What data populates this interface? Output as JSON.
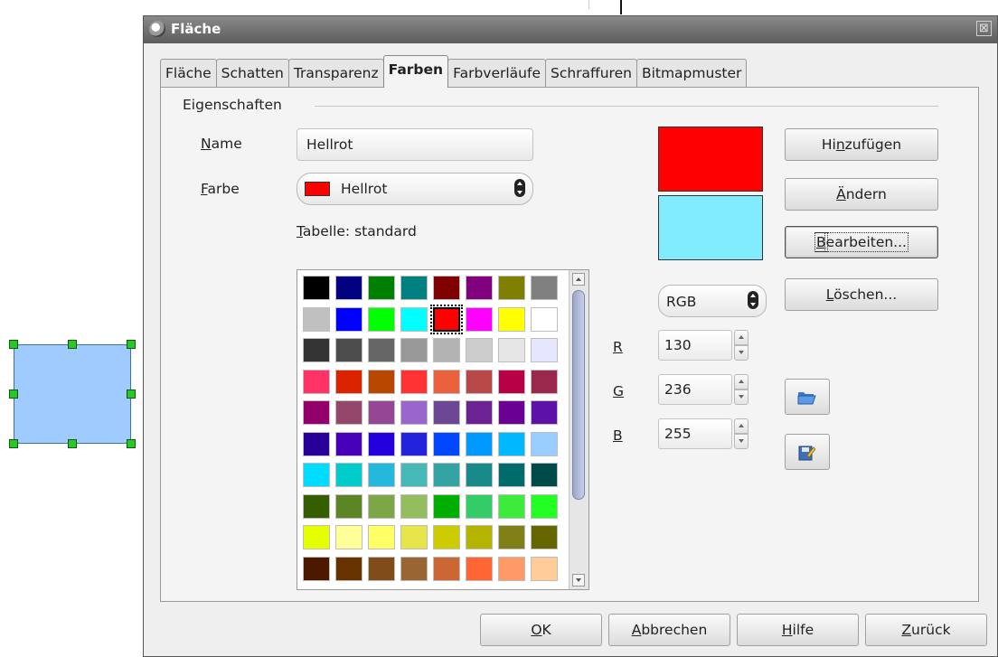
{
  "dialog": {
    "title": "Fläche",
    "close_glyph": "⊠"
  },
  "tabs": [
    {
      "label": "Fläche"
    },
    {
      "label": "Schatten"
    },
    {
      "label": "Transparenz"
    },
    {
      "label": "Farben",
      "active": true
    },
    {
      "label": "Farbverläufe"
    },
    {
      "label": "Schraffuren"
    },
    {
      "label": "Bitmapmuster"
    }
  ],
  "properties": {
    "section_title": "Eigenschaften",
    "name_label_u": "N",
    "name_label_rest": "ame",
    "name_value": "Hellrot",
    "color_label_u": "F",
    "color_label_rest": "arbe",
    "color_value": "Hellrot",
    "color_swatch": "#ff0000",
    "table_label_u": "T",
    "table_label_rest": "abelle: standard"
  },
  "palette": [
    [
      "#000000",
      "#000080",
      "#008000",
      "#008080",
      "#800000",
      "#800080",
      "#808000",
      "#808080"
    ],
    [
      "#c0c0c0",
      "#0000ff",
      "#00ff00",
      "#00ffff",
      "#ff0000",
      "#ff00ff",
      "#ffff00",
      "#ffffff"
    ],
    [
      "#333333",
      "#4d4d4d",
      "#666666",
      "#999999",
      "#b3b3b3",
      "#cccccc",
      "#e6e6e6",
      "#e6e6ff"
    ],
    [
      "#ff3366",
      "#dc2300",
      "#b84700",
      "#ff3333",
      "#eb613d",
      "#b84747",
      "#b80047",
      "#99284c"
    ],
    [
      "#94006b",
      "#94476b",
      "#944794",
      "#9966cc",
      "#6b4794",
      "#6b2394",
      "#6b0094",
      "#5e11a6"
    ],
    [
      "#280099",
      "#4700b8",
      "#2300dc",
      "#2323dc",
      "#0047ff",
      "#0099ff",
      "#00b8ff",
      "#99ccff"
    ],
    [
      "#00dcff",
      "#00cccc",
      "#23b8dc",
      "#47b8b8",
      "#33a3a3",
      "#198a8a",
      "#006b6b",
      "#004a4a"
    ],
    [
      "#355e00",
      "#5c8526",
      "#7da647",
      "#94bd5e",
      "#00ae00",
      "#33cc66",
      "#3deb3d",
      "#23ff23"
    ],
    [
      "#e6ff00",
      "#ffff99",
      "#ffff66",
      "#e6e64c",
      "#cccc00",
      "#b3b300",
      "#808019",
      "#666600"
    ],
    [
      "#4c1900",
      "#663300",
      "#804c19",
      "#996633",
      "#cc6633",
      "#ff6633",
      "#ff9966",
      "#ffcc99"
    ]
  ],
  "selected_color": {
    "row": 1,
    "col": 4
  },
  "preview": {
    "new_color": "#ff0000",
    "old_color": "#82ecff"
  },
  "color_model": {
    "value": "RGB"
  },
  "rgb": {
    "r_label": "R",
    "r_value": "130",
    "g_label": "G",
    "g_value": "236",
    "b_label": "B",
    "b_value": "255"
  },
  "buttons": {
    "add_pre": "Hi",
    "add_u": "n",
    "add_post": "zufügen",
    "modify_u": "Ä",
    "modify_post": "ndern",
    "edit_u": "B",
    "edit_post": "earbeiten...",
    "delete_u": "L",
    "delete_post": "öschen...",
    "ok_u": "O",
    "ok_post": "K",
    "cancel_u": "A",
    "cancel_post": "bbrechen",
    "help_u": "H",
    "help_post": "ilfe",
    "reset_u": "Z",
    "reset_post": "urück"
  },
  "colors": {
    "shape_fill": "#9fcbff",
    "handle": "#28c828"
  }
}
